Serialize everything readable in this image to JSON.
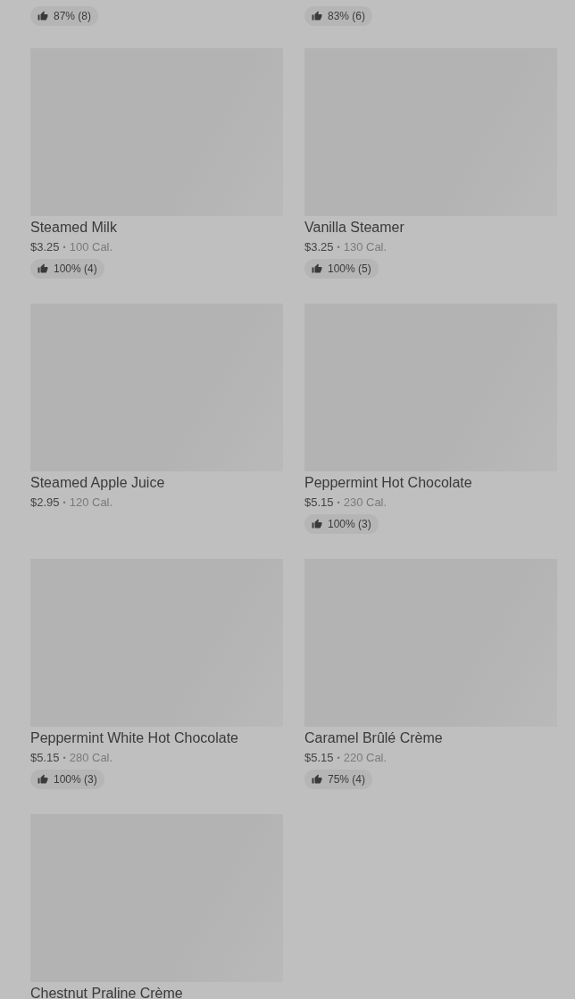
{
  "separator": "•",
  "top_ratings": [
    "87% (8)",
    "83% (6)"
  ],
  "items": [
    {
      "name": "Steamed Milk",
      "price": "$3.25",
      "calories": "100 Cal.",
      "rating": "100% (4)"
    },
    {
      "name": "Vanilla Steamer",
      "price": "$3.25",
      "calories": "130 Cal.",
      "rating": "100% (5)"
    },
    {
      "name": "Steamed Apple Juice",
      "price": "$2.95",
      "calories": "120 Cal."
    },
    {
      "name": "Peppermint Hot Chocolate",
      "price": "$5.15",
      "calories": "230 Cal.",
      "rating": "100% (3)"
    },
    {
      "name": "Peppermint White Hot Chocolate",
      "price": "$5.15",
      "calories": "280 Cal.",
      "rating": "100% (3)"
    },
    {
      "name": "Caramel Brûlé Crème",
      "price": "$5.15",
      "calories": "220 Cal.",
      "rating": "75% (4)"
    },
    {
      "name": "Chestnut Praline Crème"
    }
  ]
}
